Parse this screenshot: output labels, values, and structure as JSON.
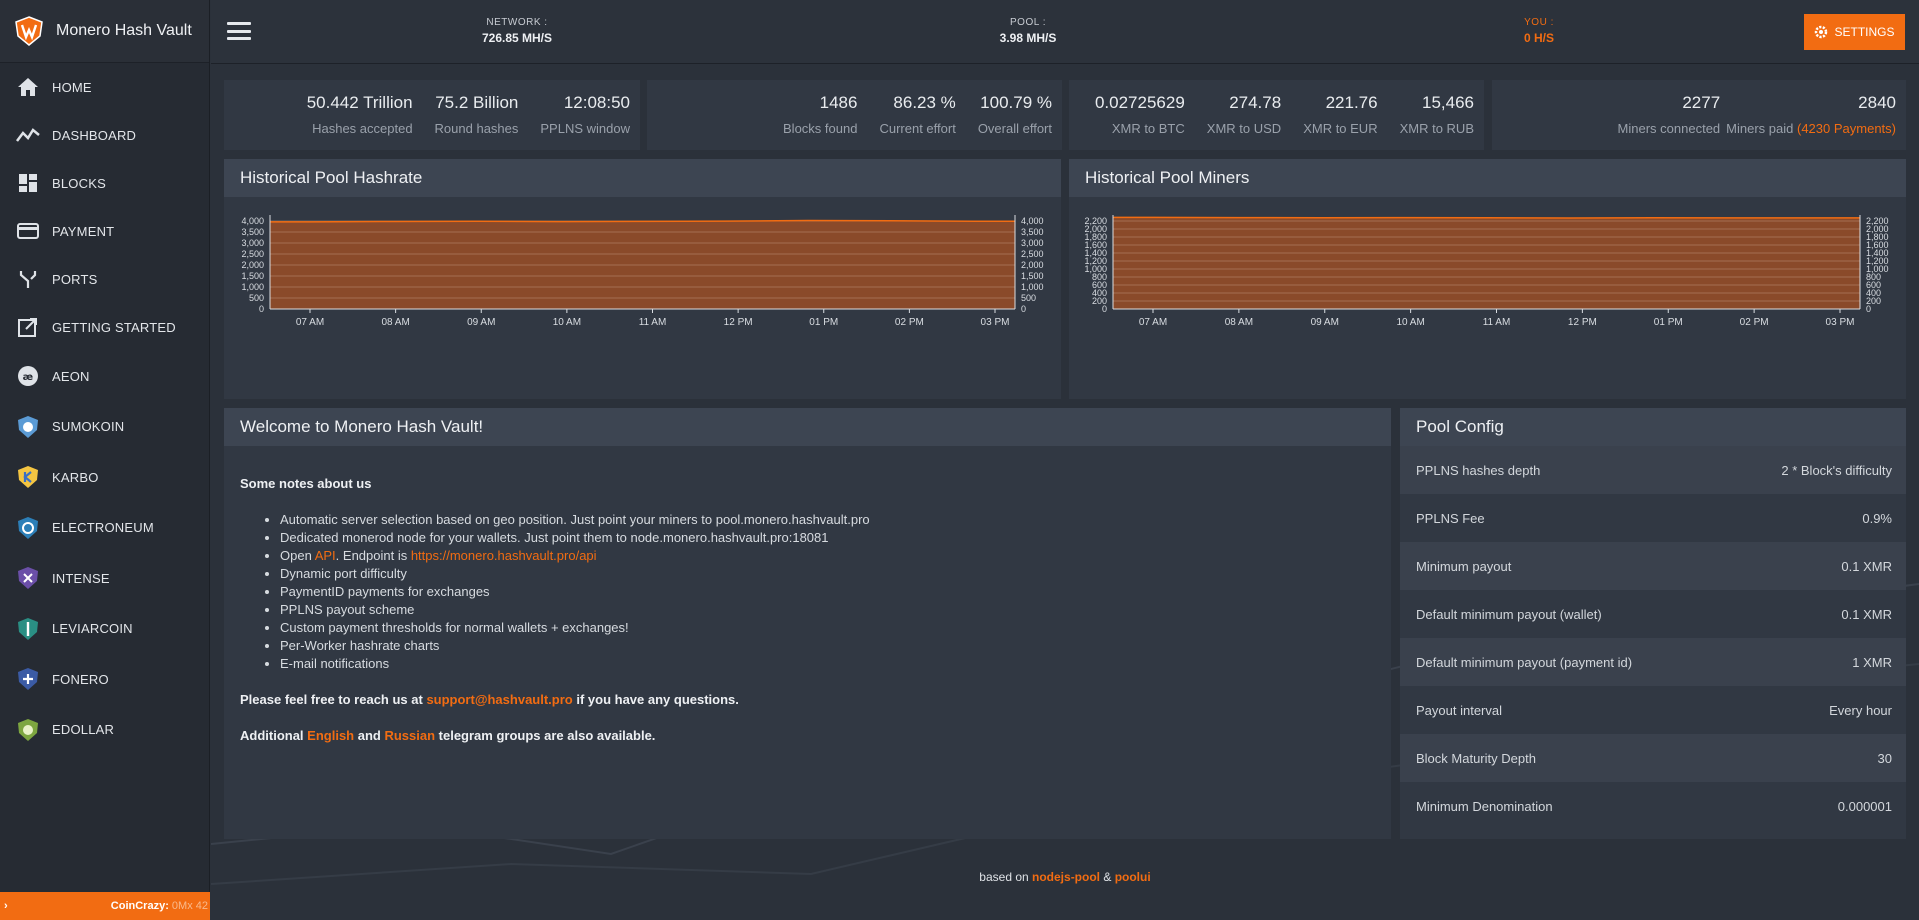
{
  "brand": {
    "title": "Monero Hash Vault",
    "accent": "#f26c12"
  },
  "sidebar": {
    "items": [
      {
        "label": "HOME",
        "icon": "home-icon"
      },
      {
        "label": "DASHBOARD",
        "icon": "chart-line-icon"
      },
      {
        "label": "BLOCKS",
        "icon": "blocks-icon"
      },
      {
        "label": "PAYMENT",
        "icon": "credit-card-icon"
      },
      {
        "label": "PORTS",
        "icon": "fork-icon"
      },
      {
        "label": "GETTING STARTED",
        "icon": "external-link-icon"
      }
    ],
    "coins": [
      {
        "label": "AEON",
        "icon": "aeon-icon"
      },
      {
        "label": "SUMOKOIN",
        "icon": "sumokoin-icon"
      },
      {
        "label": "KARBO",
        "icon": "karbo-icon"
      },
      {
        "label": "ELECTRONEUM",
        "icon": "electroneum-icon"
      },
      {
        "label": "INTENSE",
        "icon": "intense-icon"
      },
      {
        "label": "LEVIARCOIN",
        "icon": "leviarcoin-icon"
      },
      {
        "label": "FONERO",
        "icon": "fonero-icon"
      },
      {
        "label": "EDOLLAR",
        "icon": "edollar-icon"
      }
    ],
    "footer": {
      "arrow": "›",
      "ticker_label": "CoinCrazy:",
      "ticker_rest": "0Mx 42"
    }
  },
  "topbar": {
    "network": {
      "label": "NETWORK :",
      "value": "726.85 MH/S"
    },
    "pool": {
      "label": "POOL :",
      "value": "3.98 MH/S"
    },
    "you": {
      "label": "YOU :",
      "value": "0 H/S"
    },
    "settings_label": "SETTINGS"
  },
  "stats": {
    "card1": [
      {
        "value": "50.442 Trillion",
        "label": "Hashes accepted"
      },
      {
        "value": "75.2 Billion",
        "label": "Round hashes"
      },
      {
        "value": "12:08:50",
        "label": "PPLNS window"
      }
    ],
    "card2": [
      {
        "value": "1486",
        "label": "Blocks found"
      },
      {
        "value": "86.23 %",
        "label": "Current effort"
      },
      {
        "value": "100.79 %",
        "label": "Overall effort"
      }
    ],
    "card3": [
      {
        "value": "0.02725629",
        "label": "XMR to BTC"
      },
      {
        "value": "274.78",
        "label": "XMR to USD"
      },
      {
        "value": "221.76",
        "label": "XMR to EUR"
      },
      {
        "value": "15,466",
        "label": "XMR to RUB"
      }
    ],
    "card4": [
      {
        "value": "2277",
        "label": "Miners connected"
      },
      {
        "value": "2840",
        "label": "Miners paid",
        "extra": "(4230 Payments)"
      }
    ]
  },
  "charts_titles": {
    "hashrate": "Historical Pool Hashrate",
    "miners": "Historical Pool Miners"
  },
  "chart_data": [
    {
      "type": "area",
      "x": [
        "07 AM",
        "08 AM",
        "09 AM",
        "10 AM",
        "11 AM",
        "12 PM",
        "01 PM",
        "02 PM",
        "03 PM"
      ],
      "y": [
        3960,
        3980,
        3990,
        3970,
        3985,
        3995,
        4020,
        4010,
        3990
      ],
      "ylim": [
        0,
        4000
      ],
      "yticks": [
        "0",
        "500",
        "1,000",
        "1,500",
        "2,000",
        "2,500",
        "3,000",
        "3,500",
        "4,000"
      ],
      "color": "#8a4a2a",
      "line_color": "#f26c12"
    },
    {
      "type": "area",
      "x": [
        "07 AM",
        "08 AM",
        "09 AM",
        "10 AM",
        "11 AM",
        "12 PM",
        "01 PM",
        "02 PM",
        "03 PM"
      ],
      "y": [
        2290,
        2285,
        2280,
        2285,
        2280,
        2275,
        2280,
        2278,
        2277
      ],
      "ylim": [
        0,
        2200
      ],
      "yticks": [
        "0",
        "200",
        "400",
        "600",
        "800",
        "1,000",
        "1,200",
        "1,400",
        "1,600",
        "1,800",
        "2,000",
        "2,200"
      ],
      "color": "#8a4a2a",
      "line_color": "#f26c12"
    }
  ],
  "welcome": {
    "title": "Welcome to Monero Hash Vault!",
    "notes_heading": "Some notes about us",
    "bullets": [
      "Automatic server selection based on geo position. Just point your miners to pool.monero.hashvault.pro",
      "Dedicated monerod node for your wallets. Just point them to node.monero.hashvault.pro:18081"
    ],
    "api_line": {
      "pre": "Open ",
      "api": "API",
      "mid": ". Endpoint is ",
      "url": "https://monero.hashvault.pro/api"
    },
    "bullets2": [
      "Dynamic port difficulty",
      "PaymentID payments for exchanges",
      "PPLNS payout scheme",
      "Custom payment thresholds for normal wallets + exchanges!",
      "Per-Worker hashrate charts",
      "E-mail notifications"
    ],
    "contact": {
      "pre": "Please feel free to reach us at ",
      "email": "support@hashvault.pro",
      "post": " if you have any questions."
    },
    "telegram": {
      "pre": "Additional ",
      "english": "English",
      "and": " and ",
      "russian": "Russian",
      "post": " telegram groups are also available."
    }
  },
  "pool_config": {
    "title": "Pool Config",
    "rows": [
      {
        "label": "PPLNS hashes depth",
        "value": "2 * Block's difficulty"
      },
      {
        "label": "PPLNS Fee",
        "value": "0.9%"
      },
      {
        "label": "Minimum payout",
        "value": "0.1 XMR"
      },
      {
        "label": "Default minimum payout (wallet)",
        "value": "0.1 XMR"
      },
      {
        "label": "Default minimum payout (payment id)",
        "value": "1 XMR"
      },
      {
        "label": "Payout interval",
        "value": "Every hour"
      },
      {
        "label": "Block Maturity Depth",
        "value": "30"
      },
      {
        "label": "Minimum Denomination",
        "value": "0.000001"
      }
    ]
  },
  "footer": {
    "pre": "based on ",
    "link1": "nodejs-pool",
    "amp": " & ",
    "link2": "poolui"
  }
}
